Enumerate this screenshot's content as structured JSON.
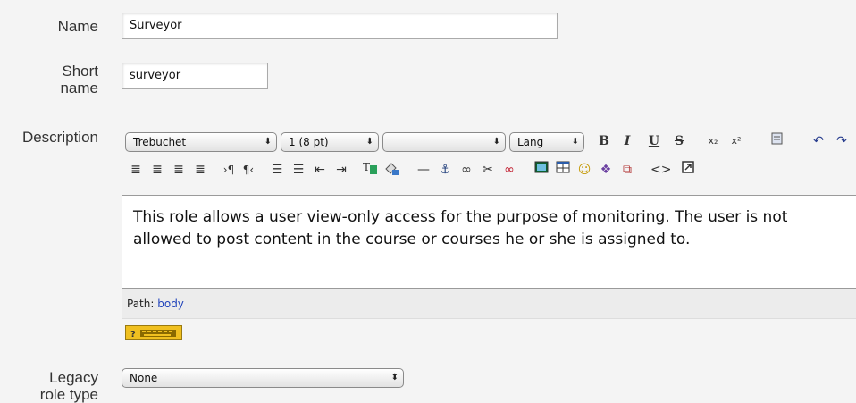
{
  "fields": {
    "name": {
      "label": "Name",
      "value": "Surveyor"
    },
    "shortname": {
      "label_line1": "Short",
      "label_line2": "name",
      "value": "surveyor"
    },
    "description": {
      "label": "Description"
    },
    "legacy": {
      "label_line1": "Legacy",
      "label_line2": "role type",
      "value": "None"
    }
  },
  "toolbar": {
    "font_family": "Trebuchet",
    "font_size": "1 (8 pt)",
    "format": "",
    "lang": "Lang",
    "bold": "B",
    "italic": "I",
    "underline": "U",
    "strike": "S",
    "subscript": "x₂",
    "superscript": "x²"
  },
  "editor": {
    "content": "This role allows a user view-only access for the purpose of monitoring. The user is not allowed to post content in the course or courses he or she is assigned to."
  },
  "pathbar": {
    "label": "Path:",
    "value": "body"
  },
  "colors": {
    "background": "#f4f4f4",
    "link": "#2244bb",
    "help_badge": "#f0c020"
  }
}
